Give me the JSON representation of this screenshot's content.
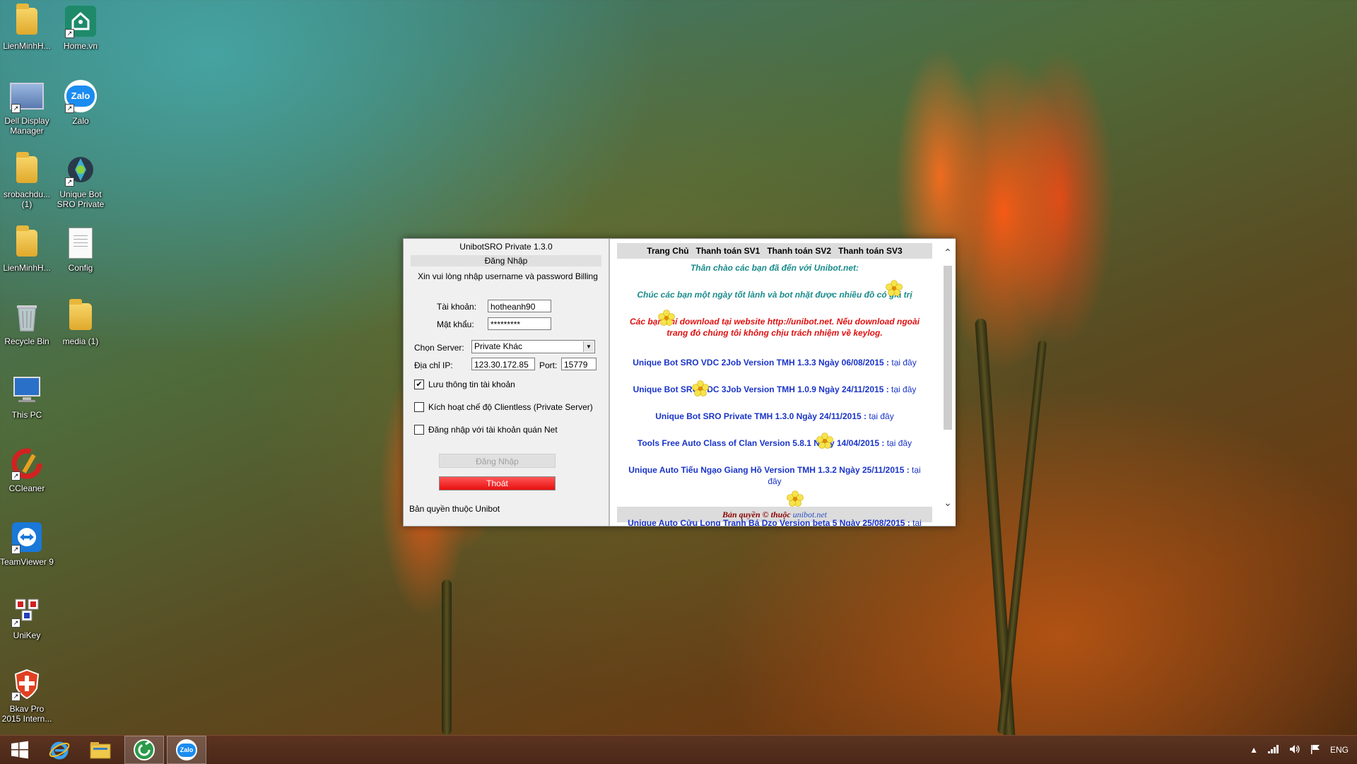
{
  "desktop": {
    "icons": [
      {
        "label": "LienMinhH...",
        "type": "folder"
      },
      {
        "label": "Home.vn",
        "type": "app"
      },
      {
        "label": "Dell Display Manager",
        "type": "app"
      },
      {
        "label": "Zalo",
        "type": "app"
      },
      {
        "label": "srobachdu... (1)",
        "type": "folder"
      },
      {
        "label": "Unique Bot SRO Private",
        "type": "app"
      },
      {
        "label": "LienMinhH...",
        "type": "folder"
      },
      {
        "label": "Config",
        "type": "file"
      },
      {
        "label": "Recycle Bin",
        "type": "app"
      },
      {
        "label": "media (1)",
        "type": "folder"
      },
      {
        "label": "This PC",
        "type": "app"
      },
      {
        "label": "CCleaner",
        "type": "app"
      },
      {
        "label": "TeamViewer 9",
        "type": "app"
      },
      {
        "label": "UniKey",
        "type": "app"
      },
      {
        "label": "Bkav Pro 2015 Intern...",
        "type": "app"
      }
    ],
    "zalo_icon_text": "Zalo"
  },
  "app": {
    "title": "UnibotSRO Private 1.3.0",
    "subtitle": "Đăng Nhập",
    "prompt": "Xin vui lòng nhập username và password Billing",
    "username_label": "Tài khoản:",
    "username_value": "hotheanh90",
    "password_label": "Mật khẩu:",
    "password_value": "*********",
    "server_label": "Chọn Server:",
    "server_value": "Private Khác",
    "ip_label": "Địa chỉ IP:",
    "ip_value": "123.30.172.85",
    "port_label": "Port:",
    "port_value": "15779",
    "checkboxes": [
      {
        "label": "Lưu thông tin tài khoản",
        "checked": true
      },
      {
        "label": "Kích hoạt chế độ Clientless (Private Server)",
        "checked": false
      },
      {
        "label": "Đăng nhập với tài khoản quán Net",
        "checked": false
      }
    ],
    "checkmark": "✔",
    "login_button": "Đăng Nhập",
    "exit_button": "Thoát",
    "copyright": "Bản quyền thuộc Unibot"
  },
  "web": {
    "nav": [
      "Trang Chủ",
      "Thanh toán SV1",
      "Thanh toán SV2",
      "Thanh toán SV3"
    ],
    "welcome": "Thân chào các bạn đã đến với Unibot.net:",
    "wish": "Chúc các bạn một ngày tốt lành và bot nhặt được nhiều đồ có giá trị",
    "warning_1": "Các bạn chỉ download tại website http://unibot.net. Nếu download ngoài",
    "warning_2": "trang đó chúng tôi không chịu trách nhiệm về keylog.",
    "downloads": [
      {
        "text": "Unique Bot SRO VDC 2Job Version TMH 1.3.3 Ngày 06/08/2015 :",
        "link": "tại đây"
      },
      {
        "text": "Unique Bot SRO VDC 3Job Version TMH 1.0.9 Ngày 24/11/2015 :",
        "link": "tại đây"
      },
      {
        "text": "Unique Bot SRO Private TMH 1.3.0 Ngày 24/11/2015 :",
        "link": "tại đây"
      },
      {
        "text": "Tools Free Auto Class of Clan Version 5.8.1 Ngày 14/04/2015 :",
        "link": "tại đây"
      },
      {
        "text": "Unique Auto Tiếu Ngạo Giang Hồ Version TMH 1.3.2 Ngày 25/11/2015 :",
        "link": "tại",
        "link_wrap": "đây"
      },
      {
        "text": "Unique Auto Cửu Long Tranh Bá Dzo Version beta 5 Ngày 25/08/2015 :",
        "link": "tại"
      }
    ],
    "footer_text": "Bản quyền © thuộc",
    "footer_site": "unibot.net"
  },
  "taskbar": {
    "language": "ENG",
    "items": [
      "start",
      "internet-explorer",
      "file-explorer",
      "unibot",
      "zalo"
    ]
  }
}
